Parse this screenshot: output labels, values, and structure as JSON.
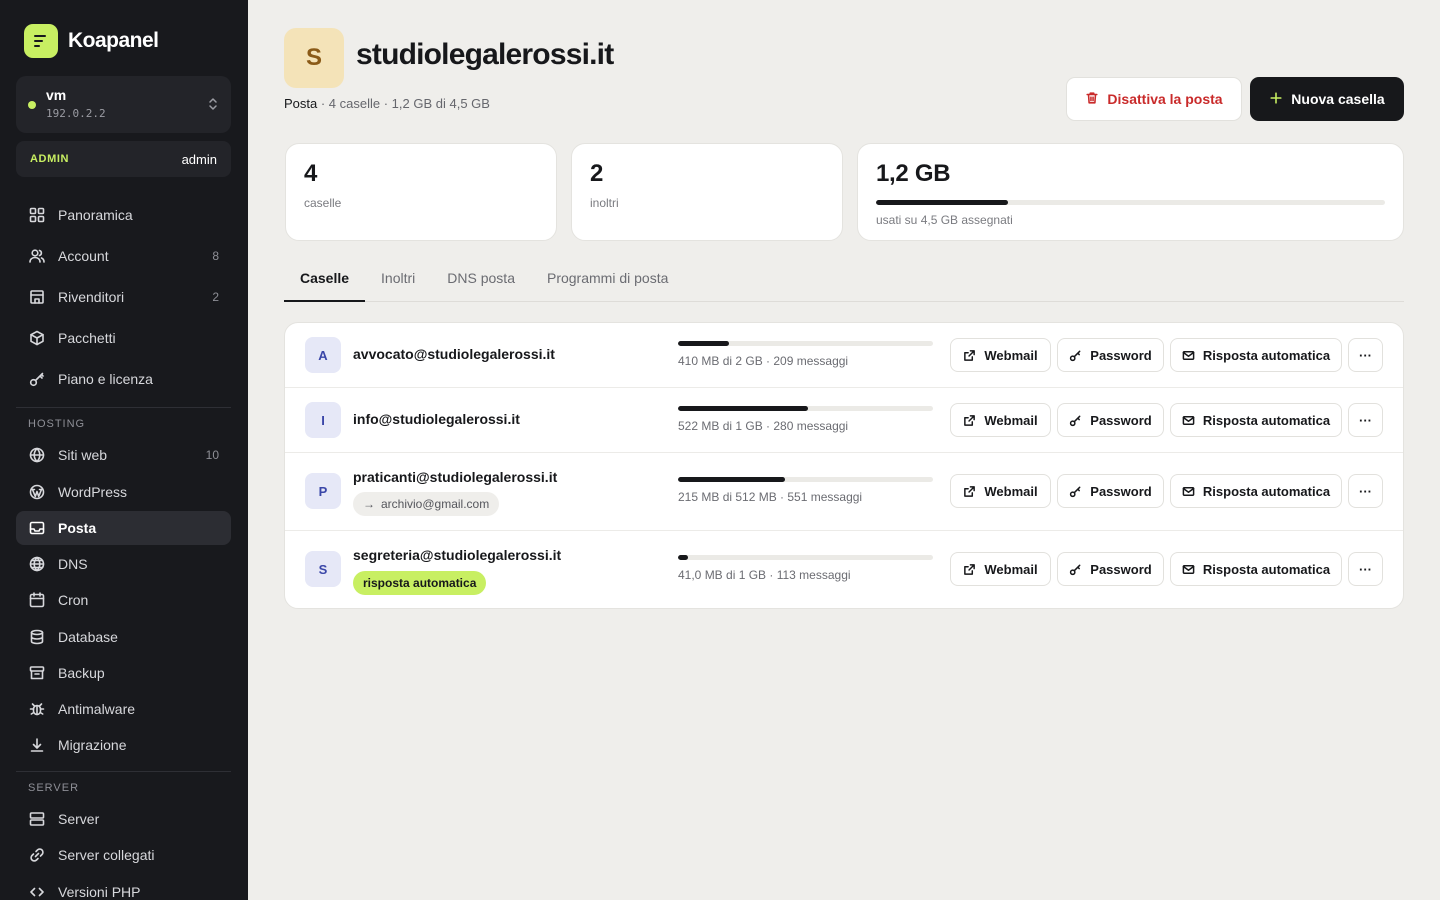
{
  "app": {
    "name": "Koapanel"
  },
  "server": {
    "name": "vm",
    "ip": "192.0.2.2",
    "status_color": "#c8ef62"
  },
  "role": {
    "badge": "ADMIN",
    "user": "admin"
  },
  "nav_main": [
    {
      "label": "Panoramica",
      "icon": "grid-icon",
      "count": ""
    },
    {
      "label": "Account",
      "icon": "users-icon",
      "count": "8"
    },
    {
      "label": "Rivenditori",
      "icon": "store-icon",
      "count": "2"
    },
    {
      "label": "Pacchetti",
      "icon": "package-icon",
      "count": ""
    },
    {
      "label": "Piano e licenza",
      "icon": "key-icon",
      "count": ""
    }
  ],
  "section_hosting": "HOSTING",
  "nav_hosting": [
    {
      "label": "Siti web",
      "icon": "globe-icon",
      "count": "10"
    },
    {
      "label": "WordPress",
      "icon": "wordpress-icon",
      "count": ""
    },
    {
      "label": "Posta",
      "icon": "inbox-icon",
      "count": "",
      "active": true
    },
    {
      "label": "DNS",
      "icon": "dns-globe-icon",
      "count": ""
    },
    {
      "label": "Cron",
      "icon": "calendar-icon",
      "count": ""
    },
    {
      "label": "Database",
      "icon": "database-icon",
      "count": ""
    },
    {
      "label": "Backup",
      "icon": "archive-icon",
      "count": ""
    },
    {
      "label": "Antimalware",
      "icon": "bug-icon",
      "count": ""
    },
    {
      "label": "Migrazione",
      "icon": "download-icon",
      "count": ""
    }
  ],
  "section_server": "SERVER",
  "nav_server": [
    {
      "label": "Server",
      "icon": "server-icon"
    },
    {
      "label": "Server collegati",
      "icon": "link-icon"
    },
    {
      "label": "Versioni PHP",
      "icon": "code-icon"
    }
  ],
  "page": {
    "initial": "S",
    "title": "studiolegalerossi.it",
    "subtitle_section": "Posta",
    "subtitle_rest": " · 4 caselle · 1,2 GB di 4,5 GB",
    "btn_disable": "Disattiva la posta",
    "btn_new": "Nuova casella"
  },
  "stats": [
    {
      "value": "4",
      "label": "caselle"
    },
    {
      "value": "2",
      "label": "inoltri"
    },
    {
      "value": "1,2 GB",
      "label": "usati su 4,5 GB assegnati",
      "fraction": 0.26
    }
  ],
  "tabs": [
    "Caselle",
    "Inoltri",
    "DNS posta",
    "Programmi di posta"
  ],
  "actions": {
    "webmail": "Webmail",
    "password": "Password",
    "autoreply": "Risposta automatica",
    "more": "···"
  },
  "mailboxes": [
    {
      "initial": "A",
      "email": "avvocato@studiolegalerossi.it",
      "usage_fraction": 0.2,
      "usage_text": "410 MB di 2 GB · 209 messaggi"
    },
    {
      "initial": "I",
      "email": "info@studiolegalerossi.it",
      "usage_fraction": 0.51,
      "usage_text": "522 MB di 1 GB · 280 messaggi"
    },
    {
      "initial": "P",
      "email": "praticanti@studiolegalerossi.it",
      "forward": "archivio@gmail.com",
      "usage_fraction": 0.42,
      "usage_text": "215 MB di 512 MB · 551 messaggi"
    },
    {
      "initial": "S",
      "email": "segreteria@studiolegalerossi.it",
      "tag": "risposta automatica",
      "usage_fraction": 0.04,
      "usage_text": "41,0 MB di 1 GB · 113 messaggi"
    }
  ]
}
